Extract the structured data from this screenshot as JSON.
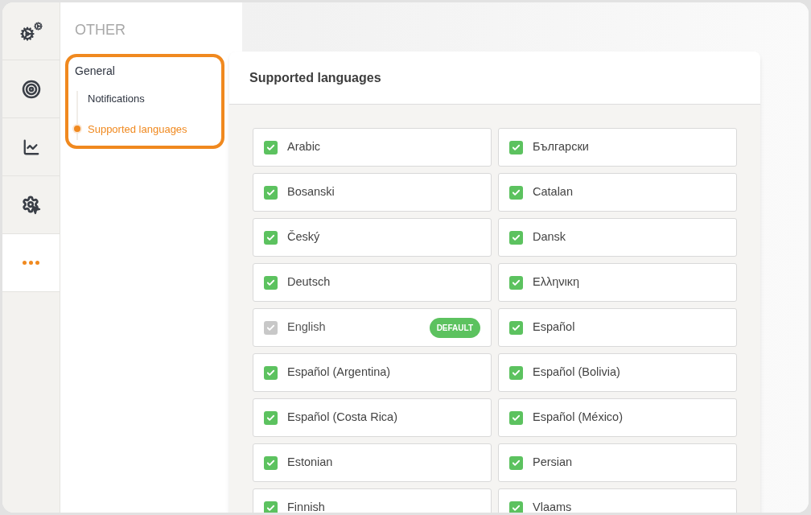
{
  "rail": [
    {
      "kind": "gears",
      "selected": false
    },
    {
      "kind": "target",
      "selected": false
    },
    {
      "kind": "chart",
      "selected": false
    },
    {
      "kind": "gear-cursor",
      "selected": false
    },
    {
      "kind": "more",
      "selected": true
    }
  ],
  "nav": {
    "section": "OTHER",
    "group": "General",
    "items": [
      {
        "label": "Notifications",
        "selected": false
      },
      {
        "label": "Supported languages",
        "selected": true
      }
    ]
  },
  "card": {
    "title": "Supported languages",
    "languages": [
      {
        "label": "Arabic",
        "checked": true,
        "disabled": false
      },
      {
        "label": "Български",
        "checked": true,
        "disabled": false
      },
      {
        "label": "Bosanski",
        "checked": true,
        "disabled": false
      },
      {
        "label": "Catalan",
        "checked": true,
        "disabled": false
      },
      {
        "label": "Český",
        "checked": true,
        "disabled": false
      },
      {
        "label": "Dansk",
        "checked": true,
        "disabled": false
      },
      {
        "label": "Deutsch",
        "checked": true,
        "disabled": false
      },
      {
        "label": "Ελληνικη",
        "checked": true,
        "disabled": false
      },
      {
        "label": "English",
        "checked": true,
        "disabled": true,
        "badge": "DEFAULT"
      },
      {
        "label": "Español",
        "checked": true,
        "disabled": false
      },
      {
        "label": "Español (Argentina)",
        "checked": true,
        "disabled": false
      },
      {
        "label": "Español (Bolivia)",
        "checked": true,
        "disabled": false
      },
      {
        "label": "Español (Costa Rica)",
        "checked": true,
        "disabled": false
      },
      {
        "label": "Español (México)",
        "checked": true,
        "disabled": false
      },
      {
        "label": "Estonian",
        "checked": true,
        "disabled": false
      },
      {
        "label": "Persian",
        "checked": true,
        "disabled": false
      },
      {
        "label": "Finnish",
        "checked": true,
        "disabled": false
      },
      {
        "label": "Vlaams",
        "checked": true,
        "disabled": false
      }
    ]
  }
}
